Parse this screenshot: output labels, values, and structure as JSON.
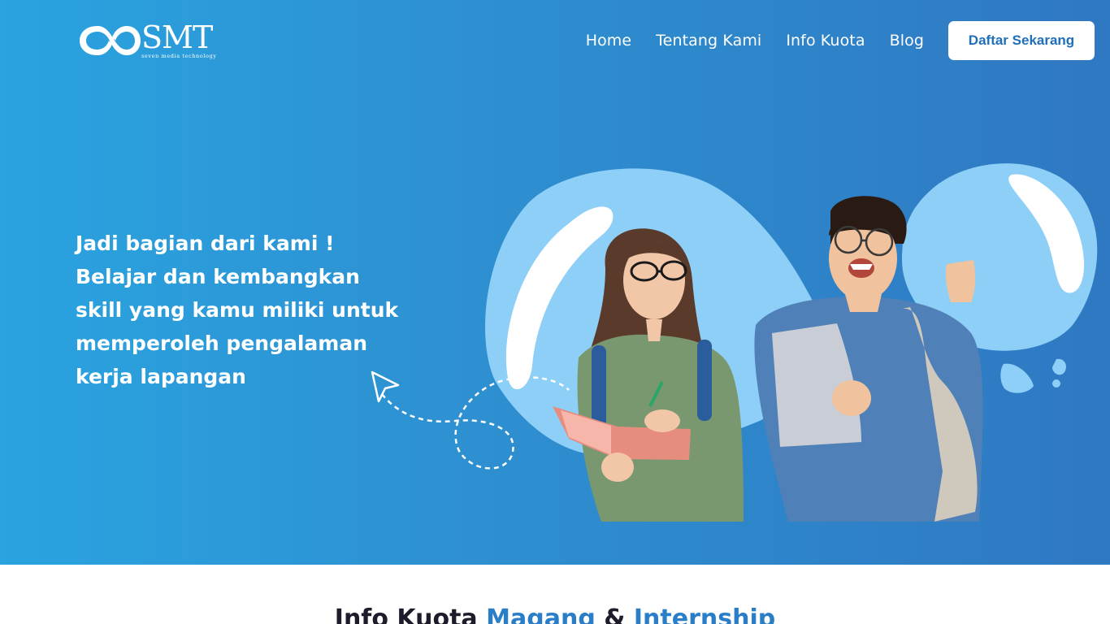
{
  "brand": {
    "name": "SMT",
    "tagline": "seven media technology"
  },
  "nav": {
    "items": [
      {
        "label": "Home",
        "name": "nav-home"
      },
      {
        "label": "Tentang Kami",
        "name": "nav-tentang-kami"
      },
      {
        "label": "Info Kuota",
        "name": "nav-info-kuota"
      },
      {
        "label": "Blog",
        "name": "nav-blog"
      }
    ],
    "cta_label": "Daftar Sekarang"
  },
  "hero": {
    "headline_lines": [
      "Jadi bagian dari kami !",
      "Belajar dan kembangkan",
      "skill yang kamu miliki untuk",
      "memperoleh pengalaman",
      "kerja lapangan"
    ]
  },
  "section": {
    "title_prefix": "Info Kuota",
    "title_accent_1": "Magang",
    "title_amp": "&",
    "title_accent_2": "Internship"
  },
  "colors": {
    "hero_gradient_start": "#2aa3e0",
    "hero_gradient_end": "#2f78c2",
    "blob": "#8ecff7",
    "cta_text": "#1f6fb8",
    "accent": "#2a7ec7"
  }
}
